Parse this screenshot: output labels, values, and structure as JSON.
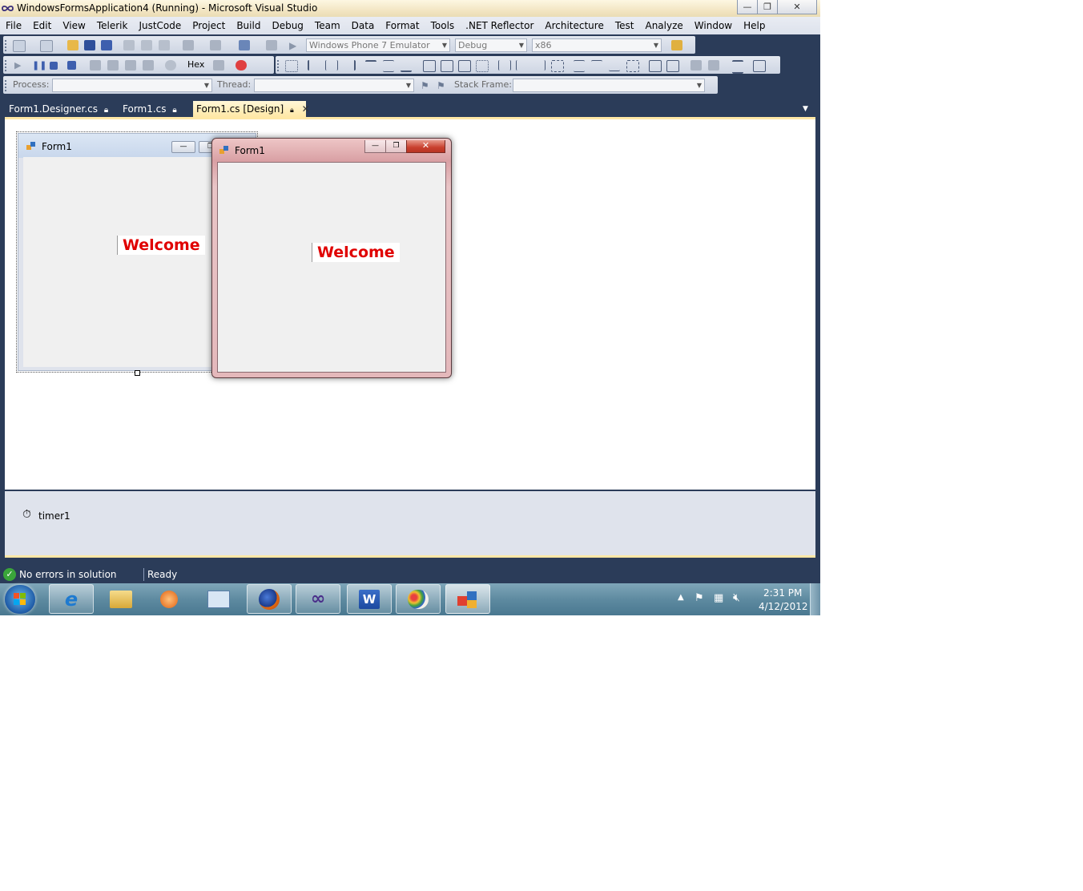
{
  "window": {
    "title": "WindowsFormsApplication4 (Running) - Microsoft Visual Studio",
    "minimize": "—",
    "restore": "❐",
    "close": "✕"
  },
  "menu": [
    "File",
    "Edit",
    "View",
    "Telerik",
    "JustCode",
    "Project",
    "Build",
    "Debug",
    "Team",
    "Data",
    "Format",
    "Tools",
    ".NET Reflector",
    "Architecture",
    "Test",
    "Analyze",
    "Window",
    "Help"
  ],
  "toolbar1": {
    "platform": "Windows Phone 7 Emulator",
    "configuration": "Debug",
    "cpu": "x86"
  },
  "toolbar2": {
    "hex_label": "Hex"
  },
  "toolbar3": {
    "process_label": "Process:",
    "thread_label": "Thread:",
    "stack_label": "Stack Frame:"
  },
  "tabs": [
    {
      "label": "Form1.Designer.cs"
    },
    {
      "label": "Form1.cs"
    },
    {
      "label": "Form1.cs [Design]"
    }
  ],
  "designer_form": {
    "title": "Form1",
    "label": "Welcome"
  },
  "running_form": {
    "title": "Form1",
    "label": "Welcome"
  },
  "tray": {
    "component": "timer1"
  },
  "status": {
    "errors": "No errors in solution",
    "state": "Ready"
  },
  "clock": {
    "time": "2:31 PM",
    "date": "4/12/2012"
  },
  "colors": {
    "chrome": "#2b3c59",
    "accent_tab": "#ffe8a6",
    "welcome": "#e00000"
  }
}
